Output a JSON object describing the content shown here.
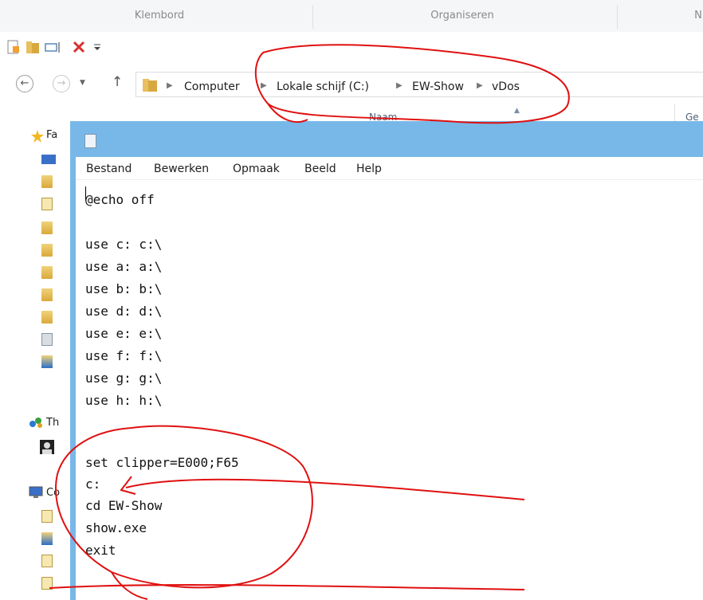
{
  "ribbon": {
    "groups": [
      "Klembord",
      "Organiseren",
      "N"
    ]
  },
  "quick_access": {
    "icons": [
      "properties-icon",
      "new-folder-icon",
      "rename-icon",
      "delete-icon",
      "customize-dropdown-icon"
    ]
  },
  "address_bar": {
    "breadcrumbs": [
      "Computer",
      "Lokale schijf (C:)",
      "EW-Show",
      "vDos"
    ]
  },
  "file_list": {
    "column_name": "Naam",
    "column_right": "Ge"
  },
  "nav_pane": {
    "favorites_label": "Fa",
    "homegroup_label": "Th",
    "computer_label": "Co"
  },
  "notepad": {
    "menu": [
      "Bestand",
      "Bewerken",
      "Opmaak",
      "Beeld",
      "Help"
    ],
    "lines": [
      "@echo off",
      "",
      "use c: c:\\",
      "use a: a:\\",
      "use b: b:\\",
      "use d: d:\\",
      "use e: e:\\",
      "use f: f:\\",
      "use g: g:\\",
      "use h: h:\\",
      "",
      "",
      "set clipper=E000;F65",
      "c:",
      "cd EW-Show",
      "show.exe",
      "exit"
    ]
  },
  "colors": {
    "annotation_red": "#e01010",
    "titlebar_blue": "#78b8e8"
  }
}
